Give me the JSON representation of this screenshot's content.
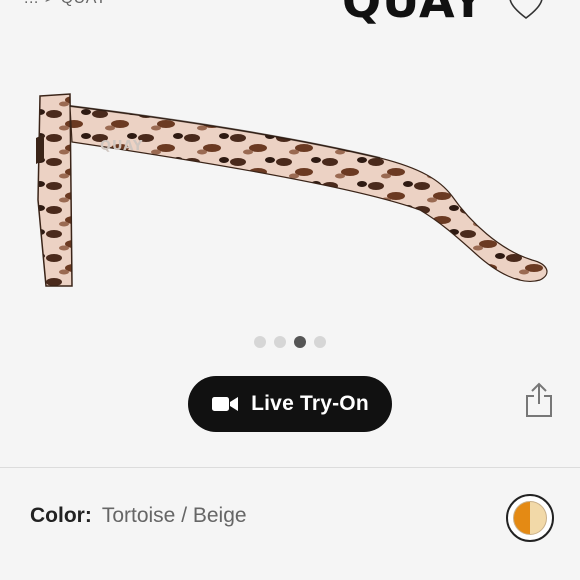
{
  "header": {
    "breadcrumb": {
      "ellipsis": "...",
      "separator": ">",
      "current": "QUAY"
    },
    "brand": "QUAY"
  },
  "product": {
    "image_alt": "Tortoise sunglasses side view",
    "arm_logo": "QUAY"
  },
  "carousel": {
    "count": 4,
    "active_index": 2
  },
  "actions": {
    "try_on_label": "Live Try-On"
  },
  "color": {
    "label": "Color:",
    "value": "Tortoise / Beige"
  },
  "colors": {
    "background": "#f5f5f5",
    "button": "#111111",
    "swatch_left": "#e48a14",
    "swatch_right": "#f2d9a8"
  },
  "icons": [
    "heart-icon",
    "video-camera-icon",
    "share-icon"
  ]
}
